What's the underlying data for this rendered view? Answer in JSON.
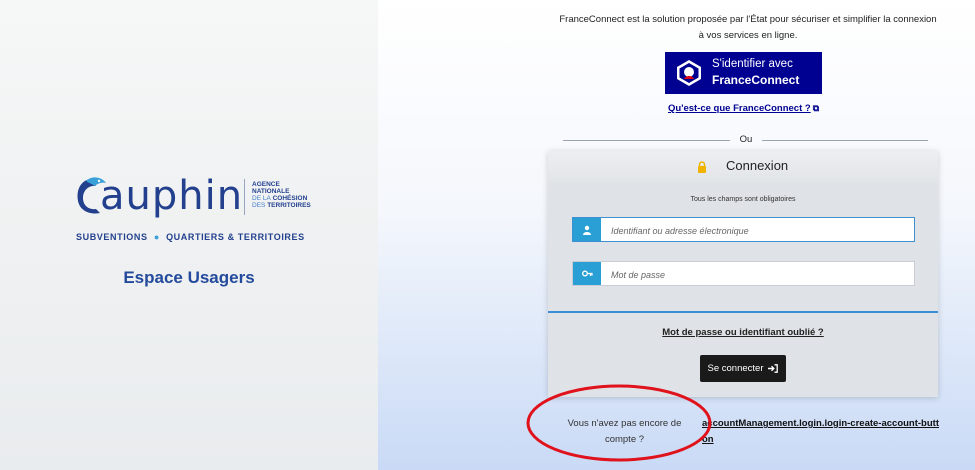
{
  "brand": {
    "name": "auphin",
    "agency_lines": [
      "AGENCE",
      "NATIONALE",
      "DE LA",
      "COHÉSION",
      "DES",
      "TERRITOIRES"
    ],
    "tagline_left": "SUBVENTIONS",
    "tagline_right": "QUARTIERS & TERRITOIRES",
    "space_title": "Espace Usagers",
    "colors": {
      "brand_blue": "#23408e",
      "accent_blue": "#3aa0d8"
    }
  },
  "franceconnect": {
    "intro": "FranceConnect est la solution proposée par l'État pour sécuriser et simplifier la connexion à vos services en ligne.",
    "button_line1": "S'identifier avec",
    "button_line2": "FranceConnect",
    "what_link": "Qu'est-ce que FranceConnect ?",
    "external_icon": "external-link-icon",
    "button_color": "#000091"
  },
  "separator": {
    "label": "Ou"
  },
  "login": {
    "title": "Connexion",
    "lock_icon": "lock-icon",
    "required_note": "Tous les champs sont obligatoires",
    "identifier": {
      "placeholder": "Identifiant ou adresse électronique",
      "value": "",
      "icon": "user-icon"
    },
    "password": {
      "placeholder": "Mot de passe",
      "value": "",
      "icon": "key-icon"
    },
    "forgot_link": "Mot de passe ou identifiant oublié ?",
    "submit_label": "Se connecter",
    "submit_icon": "sign-in-icon",
    "accent_color": "#2a9fd6"
  },
  "signup": {
    "prompt": "Vous n'avez pas encore de compte ?",
    "link": "accountManagement.login.login-create-account-button"
  },
  "annotation": {
    "color": "#e0121b"
  }
}
